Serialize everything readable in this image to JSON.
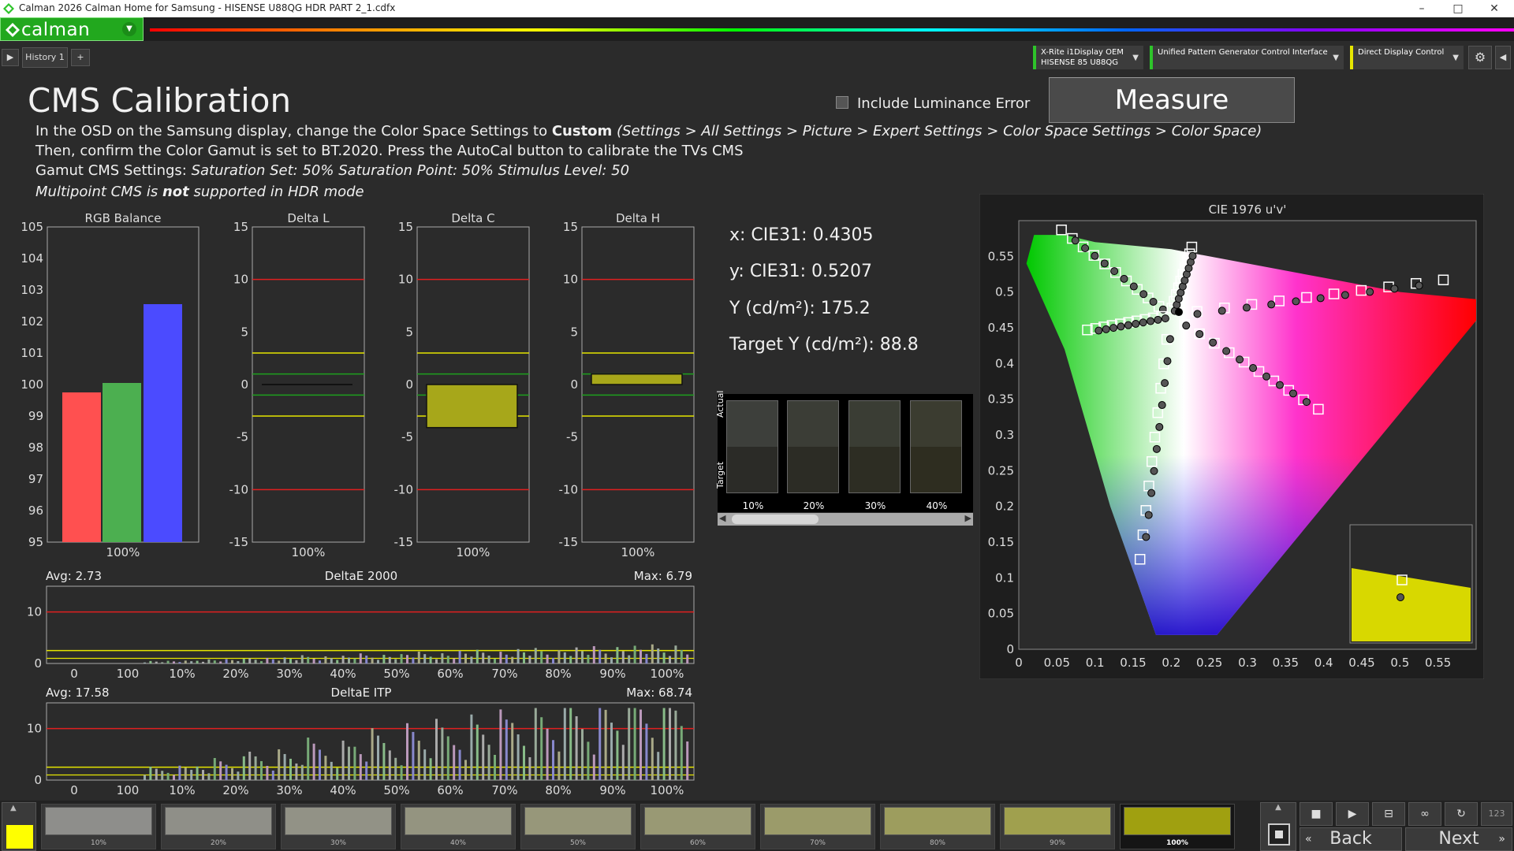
{
  "window": {
    "title": "Calman 2026 Calman Home for Samsung  - HISENSE U88QG HDR PART 2_1.cdfx",
    "minimize": "–",
    "maximize": "□",
    "close": "✕"
  },
  "brand": {
    "name": "calman"
  },
  "tabs": {
    "history_label": "History 1",
    "add_label": "+"
  },
  "devices": {
    "meter_line1": "X-Rite i1Display OEM",
    "meter_line2": "HISENSE 85 U88QG",
    "pattern": "Unified Pattern Generator Control Interface",
    "display": "Direct Display Control"
  },
  "page": {
    "title": "CMS Calibration",
    "include_luminance_error": "Include Luminance Error",
    "measure_label": "Measure",
    "line1_pre": "In the OSD on the Samsung display, change the Color Space Settings to ",
    "line1_bold": "Custom",
    "line1_path": " (Settings > All Settings > Picture > Expert Settings > Color Space Settings > Color Space)",
    "line2": "Then, confirm the Color Gamut is set to BT.2020.  Press the AutoCal button to calibrate the TVs CMS",
    "line3_pre": "Gamut CMS Settings: ",
    "line3_italic": "Saturation Set: 50%     Saturation Point: 50%     Stimulus Level: 50",
    "line4_a": "Multipoint CMS is ",
    "line4_b": "not",
    "line4_c": " supported in HDR mode"
  },
  "colors": {
    "red": "#ff5050",
    "green": "#4caf50",
    "blue": "#4b4bff",
    "yellow_line": "#e6e600",
    "red_line": "#e02020",
    "green_line": "#1ea01e",
    "delta_fill": "#a7a71a"
  },
  "rgb_balance": {
    "title": "RGB Balance",
    "y_ticks": [
      "105",
      "104",
      "103",
      "102",
      "101",
      "100",
      "99",
      "98",
      "97",
      "96",
      "95"
    ],
    "ylim": [
      95,
      105
    ],
    "values": {
      "red": 99.75,
      "green": 100.05,
      "blue": 102.55
    },
    "x_label": "100%"
  },
  "delta_l": {
    "title": "Delta L",
    "value": 0,
    "x_label": "100%"
  },
  "delta_c": {
    "title": "Delta C",
    "value": -4.1,
    "x_label": "100%"
  },
  "delta_h": {
    "title": "Delta H",
    "value": 1.0,
    "x_label": "100%"
  },
  "delta_ticks": [
    "15",
    "10",
    "5",
    "0",
    "-5",
    "-10",
    "-15"
  ],
  "measurements": {
    "x": "x: CIE31: 0.4305",
    "y": "y: CIE31: 0.5207",
    "Y": "Y (cd/m²): 175.2",
    "targetY": "Target Y (cd/m²): 88.8"
  },
  "swatches": {
    "actual_label": "Actual",
    "target_label": "Target",
    "items": [
      {
        "label": "10%",
        "actual": "#3d3f3b",
        "target": "#2b2b27"
      },
      {
        "label": "20%",
        "actual": "#3b3d36",
        "target": "#2c2c25"
      },
      {
        "label": "30%",
        "actual": "#3a3d34",
        "target": "#2d2d23"
      },
      {
        "label": "40%",
        "actual": "#3b3c30",
        "target": "#2e2d20"
      }
    ]
  },
  "deltae2000": {
    "title": "DeltaE 2000",
    "avg": "Avg: 2.73",
    "max": "Max: 6.79",
    "y_ticks": [
      "10",
      "0"
    ],
    "x_labels": [
      "0",
      "100",
      "10%",
      "20%",
      "30%",
      "40%",
      "50%",
      "60%",
      "70%",
      "80%",
      "90%",
      "100%"
    ]
  },
  "deltaeitp": {
    "title": "DeltaE ITP",
    "avg": "Avg: 17.58",
    "max": "Max: 68.74",
    "y_ticks": [
      "10",
      "0"
    ],
    "x_labels": [
      "0",
      "100",
      "10%",
      "20%",
      "30%",
      "40%",
      "50%",
      "60%",
      "70%",
      "80%",
      "90%",
      "100%"
    ]
  },
  "cie": {
    "title": "CIE 1976 u'v'",
    "x_ticks": [
      "0",
      "0.05",
      "0.1",
      "0.15",
      "0.2",
      "0.25",
      "0.3",
      "0.35",
      "0.4",
      "0.45",
      "0.5",
      "0.55"
    ],
    "y_ticks": [
      "0.55",
      "0.5",
      "0.45",
      "0.4",
      "0.35",
      "0.3",
      "0.25",
      "0.2",
      "0.15",
      "0.1",
      "0.05",
      "0"
    ]
  },
  "steps": {
    "labels": [
      "10%",
      "20%",
      "30%",
      "40%",
      "50%",
      "60%",
      "70%",
      "80%",
      "90%",
      "100%"
    ],
    "colors": [
      "#8e8e8b",
      "#8f8f88",
      "#929286",
      "#949480",
      "#97977a",
      "#999974",
      "#9b9b6a",
      "#9d9d5e",
      "#a0a04e",
      "#a0a010"
    ]
  },
  "current_swatch_color": "#ffff00",
  "nav": {
    "back": "Back",
    "next": "Next",
    "badge": "123"
  }
}
